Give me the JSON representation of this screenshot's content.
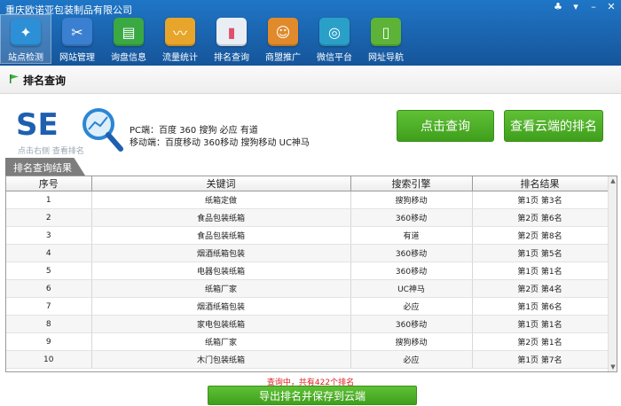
{
  "app": {
    "title": "重庆欧诺亚包装制品有限公司"
  },
  "colors": {
    "brand": "#1a62ac",
    "accent_green": "#4cae27",
    "status_red": "#e02020"
  },
  "toolbar": {
    "items": [
      {
        "label": "站点检测",
        "icon": "compass-icon",
        "color": "#2d8fd5",
        "active": true
      },
      {
        "label": "网站管理",
        "icon": "tools-icon",
        "color": "#3b7fd0"
      },
      {
        "label": "询盘信息",
        "icon": "chat-icon",
        "color": "#3aa843"
      },
      {
        "label": "流量统计",
        "icon": "trend-icon",
        "color": "#e8a52b"
      },
      {
        "label": "排名查询",
        "icon": "bar-chart-icon",
        "color": "#e9eef5"
      },
      {
        "label": "商盟推广",
        "icon": "user-icon",
        "color": "#e08a2b"
      },
      {
        "label": "微信平台",
        "icon": "wechat-icon",
        "color": "#2aa0c9"
      },
      {
        "label": "网址导航",
        "icon": "mouse-icon",
        "color": "#5cb338"
      }
    ]
  },
  "page": {
    "title": "排名查询",
    "logo_sub": "点击右侧 查看排名",
    "pc_engines": "PC端：百度 360 搜狗 必应 有道",
    "mobile_engines": "移动端：百度移动 360移动 搜狗移动 UC神马",
    "query_button": "点击查询",
    "cloud_button": "查看云端的排名",
    "result_tab": "排名查询结果"
  },
  "table": {
    "headers": [
      "序号",
      "关键词",
      "搜索引擎",
      "排名结果"
    ],
    "rows": [
      [
        "1",
        "纸箱定做",
        "搜狗移动",
        "第1页 第3名"
      ],
      [
        "2",
        "食品包装纸箱",
        "360移动",
        "第2页 第6名"
      ],
      [
        "3",
        "食品包装纸箱",
        "有道",
        "第2页 第8名"
      ],
      [
        "4",
        "烟酒纸箱包装",
        "360移动",
        "第1页 第5名"
      ],
      [
        "5",
        "电器包装纸箱",
        "360移动",
        "第1页 第1名"
      ],
      [
        "6",
        "纸箱厂家",
        "UC神马",
        "第2页 第4名"
      ],
      [
        "7",
        "烟酒纸箱包装",
        "必应",
        "第1页 第6名"
      ],
      [
        "8",
        "家电包装纸箱",
        "360移动",
        "第1页 第1名"
      ],
      [
        "9",
        "纸箱厂家",
        "搜狗移动",
        "第2页 第1名"
      ],
      [
        "10",
        "木门包装纸箱",
        "必应",
        "第1页 第7名"
      ]
    ]
  },
  "status": {
    "text": "查询中，共有422个排名"
  },
  "export_button": "导出排名并保存到云端"
}
